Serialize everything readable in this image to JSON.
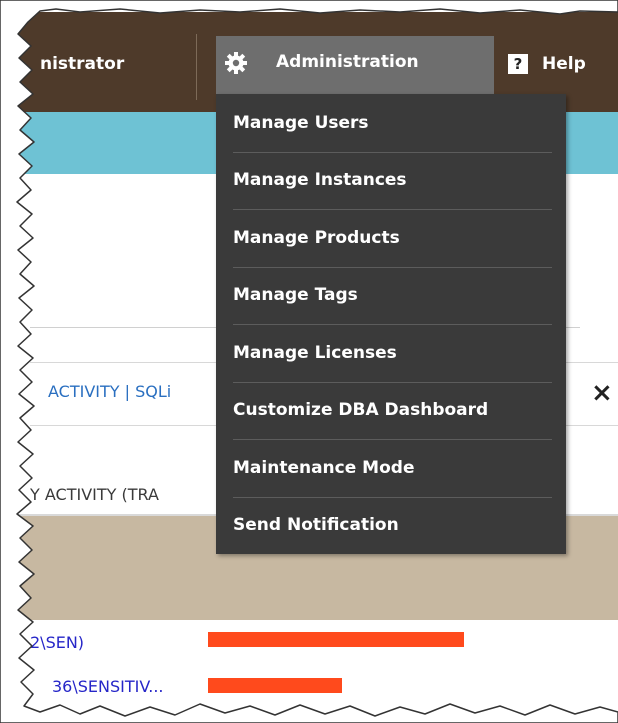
{
  "nav": {
    "user_label": "nistrator",
    "admin_label": "Administration",
    "admin_icon": "gear-icon",
    "help_icon_char": "?",
    "help_label": "Help"
  },
  "admin_menu": [
    "Manage Users",
    "Manage Instances",
    "Manage Products",
    "Manage Tags",
    "Manage Licenses",
    "Customize DBA Dashboard",
    "Maintenance Mode",
    "Send Notification"
  ],
  "panel": {
    "activity_link": "ACTIVITY | SQLi",
    "close_label": "×",
    "activity_label": "Y ACTIVITY (TRA"
  },
  "rows": [
    {
      "label": "2\\SEN)",
      "bar_fraction": 1.0
    },
    {
      "label": "36\\SENSITIV...",
      "bar_fraction": 0.52
    }
  ],
  "colors": {
    "nav_bg": "#4e3a2a",
    "admin_bg": "#6e6e6e",
    "menu_bg": "#3a3a3a",
    "teal": "#6ec2d4",
    "beige": "#c7b8a1",
    "link": "#2a6fc0",
    "row_text": "#2626c8",
    "bar": "#ff4a1c"
  }
}
